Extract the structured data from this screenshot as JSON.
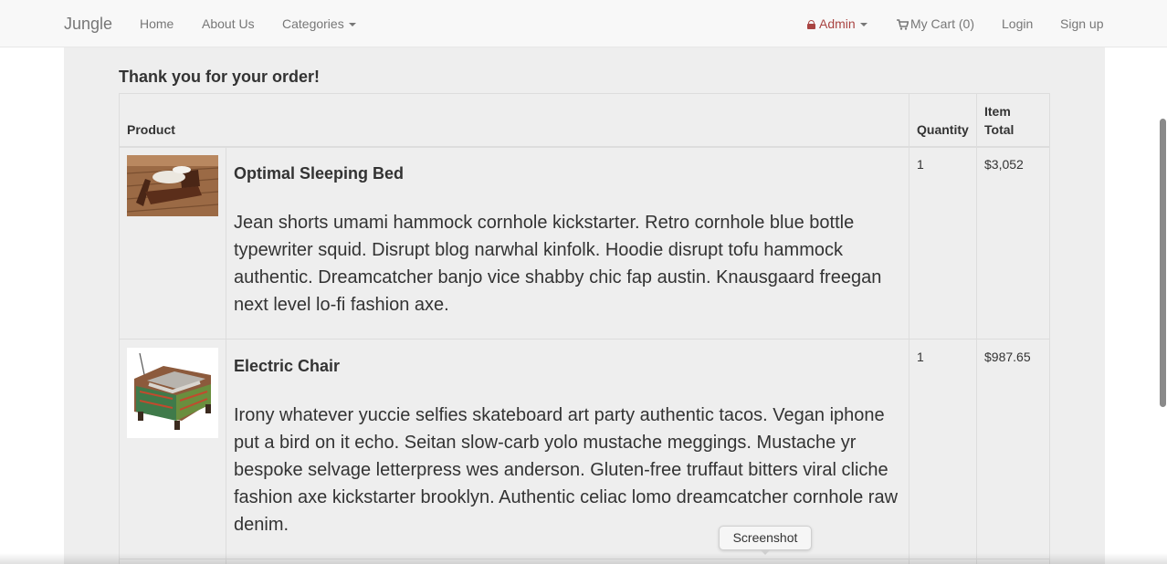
{
  "navbar": {
    "brand": "Jungle",
    "home": "Home",
    "about": "About Us",
    "categories": "Categories",
    "admin": "Admin",
    "cart": "My Cart (0)",
    "login": "Login",
    "signup": "Sign up"
  },
  "icons": {
    "admin_icon": "lock-icon",
    "cart_icon": "shopping-cart-icon"
  },
  "colors": {
    "admin_accent": "#a94442",
    "navbar_bg": "#f8f8f8",
    "content_bg": "#eeeeee"
  },
  "page": {
    "heading": "Thank you for your order!"
  },
  "table": {
    "headers": {
      "product": "Product",
      "quantity": "Quantity",
      "item_total_line1": "Item",
      "item_total_line2": "Total"
    },
    "rows": [
      {
        "name": "Optimal Sleeping Bed",
        "description": "Jean shorts umami hammock cornhole kickstarter. Retro cornhole blue bottle typewriter squid. Disrupt blog narwhal kinfolk. Hoodie disrupt tofu hammock authentic. Dreamcatcher banjo vice shabby chic fap austin. Knausgaard freegan next level lo-fi fashion axe.",
        "quantity": "1",
        "total": "$3,052"
      },
      {
        "name": "Electric Chair",
        "description": "Irony whatever yuccie selfies skateboard art party authentic tacos. Vegan iphone put a bird on it echo. Seitan slow-carb yolo mustache meggings. Mustache yr bespoke selvage letterpress wes anderson. Gluten-free truffaut bitters viral cliche fashion axe kickstarter brooklyn. Authentic celiac lomo dreamcatcher cornhole raw denim.",
        "quantity": "1",
        "total": "$987.65"
      }
    ]
  },
  "tooltip": {
    "label": "Screenshot"
  }
}
